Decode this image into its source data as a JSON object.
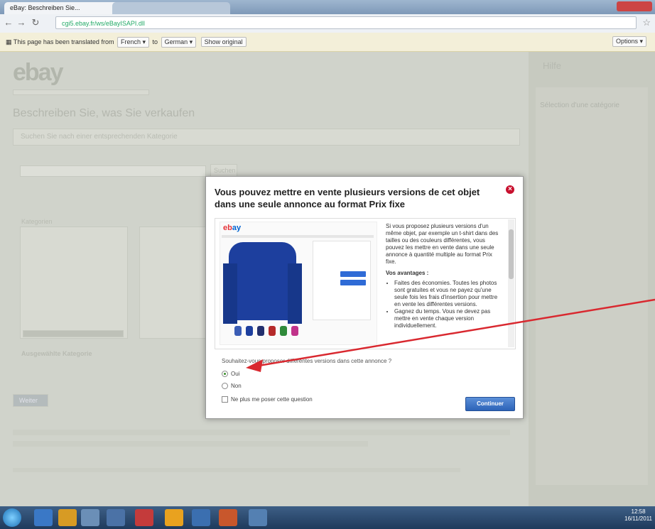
{
  "browser": {
    "tabs": [
      {
        "label": "eBay: Beschreiben Sie..."
      },
      {
        "label": ""
      }
    ],
    "url": "cgi5.ebay.fr/ws/eBayISAPI.dll",
    "star_icon": "star-icon"
  },
  "translate_bar": {
    "prefix": "This page has been translated from",
    "from_lang": "French",
    "to_word": "to",
    "to_lang": "German",
    "show_original": "Show original",
    "options": "Options"
  },
  "page": {
    "logo": "ebay",
    "title": "Beschreiben Sie, was Sie verkaufen",
    "section_heading": "Suchen Sie nach einer entsprechenden Kategorie",
    "help_heading": "Hilfe",
    "help_sub": "Sélection d'une catégorie",
    "search_button": "Suchen",
    "categories_label": "Kategorien",
    "selected_category": "Ausgewählte Kategorie",
    "weiter_button": "Weiter"
  },
  "dialog": {
    "title": "Vous pouvez mettre en vente plusieurs versions de cet objet dans une seule annonce au format Prix fixe",
    "description": "Si vous proposez plusieurs versions d'un même objet, par exemple un t-shirt dans des tailles ou des couleurs différentes, vous pouvez les mettre en vente dans une seule annonce à quantité multiple au format Prix fixe.",
    "advantages_heading": "Vos avantages :",
    "advantages": [
      "Faites des économies. Toutes les photos sont gratuites et vous ne payez qu'une seule fois les frais d'insertion pour mettre en vente les différentes versions.",
      "Gagnez du temps. Vous ne devez pas mettre en vente chaque version individuellement."
    ],
    "question": "Souhaitez-vous proposer différentes versions dans cette annonce ?",
    "options": [
      "Oui",
      "Non"
    ],
    "selected_option": "Oui",
    "dont_ask": "Ne plus me poser cette question",
    "continue_button": "Continuer"
  },
  "taskbar": {
    "time": "12:58",
    "date": "16/11/2011"
  }
}
